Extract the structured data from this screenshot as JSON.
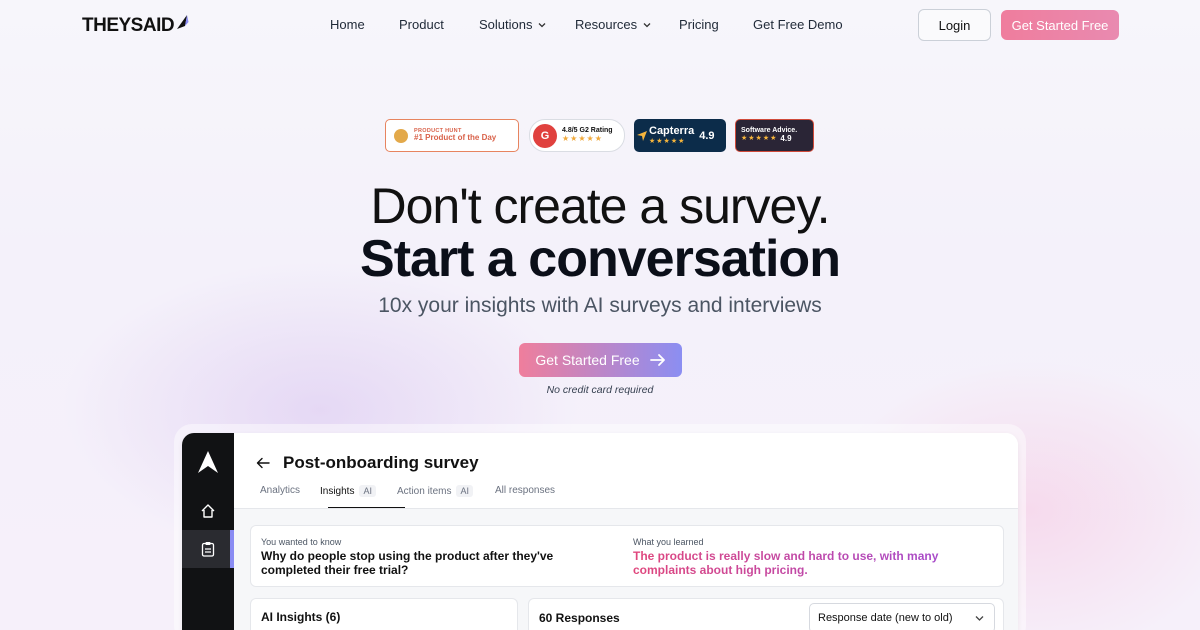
{
  "brand": {
    "logo_text": "THEYSAID"
  },
  "nav": {
    "links": [
      "Home",
      "Product",
      "Solutions",
      "Resources",
      "Pricing",
      "Get Free Demo"
    ],
    "login_label": "Login",
    "cta_label": "Get Started Free"
  },
  "badges": {
    "product_hunt": {
      "top": "PRODUCT HUNT",
      "main": "#1 Product of the Day"
    },
    "g2": {
      "logo": "G",
      "rating": "4.8/5 G2 Rating",
      "stars": "★★★★★"
    },
    "capterra": {
      "name": "Capterra",
      "score": "4.9",
      "stars": "★★★★★"
    },
    "software_advice": {
      "name": "Software Advice.",
      "score": "4.9",
      "stars": "★★★★★"
    }
  },
  "hero": {
    "line1": "Don't create a survey.",
    "line2": "Start a conversation",
    "subtitle": "10x your insights with AI surveys and interviews",
    "cta_label": "Get Started Free",
    "note": "No credit card required"
  },
  "app": {
    "title": "Post-onboarding survey",
    "tabs": [
      {
        "label": "Analytics",
        "chip": ""
      },
      {
        "label": "Insights",
        "chip": "AI"
      },
      {
        "label": "Action items",
        "chip": "AI"
      },
      {
        "label": "All responses",
        "chip": ""
      }
    ],
    "active_tab": "Insights",
    "know": {
      "label": "You wanted to know",
      "question": "Why do people stop using the product after they've completed their free trial?"
    },
    "learned": {
      "label": "What you learned",
      "answer": "The product is really slow and hard to use, with many complaints about high pricing."
    },
    "insights_title": "AI Insights (6)",
    "responses_title": "60 Responses",
    "sort_select": "Response date (new to old)"
  },
  "colors": {
    "cta_pink": "#ef7d9d",
    "cta_violet": "#8b8ef2",
    "sidebar_bg": "#111214",
    "learned_gradient_start": "#e0467c",
    "learned_gradient_end": "#a34bd0"
  },
  "icons": [
    "logo-mark-icon",
    "chevron-down-icon",
    "arrow-right-icon",
    "back-arrow-icon",
    "home-icon",
    "clipboard-icon"
  ]
}
